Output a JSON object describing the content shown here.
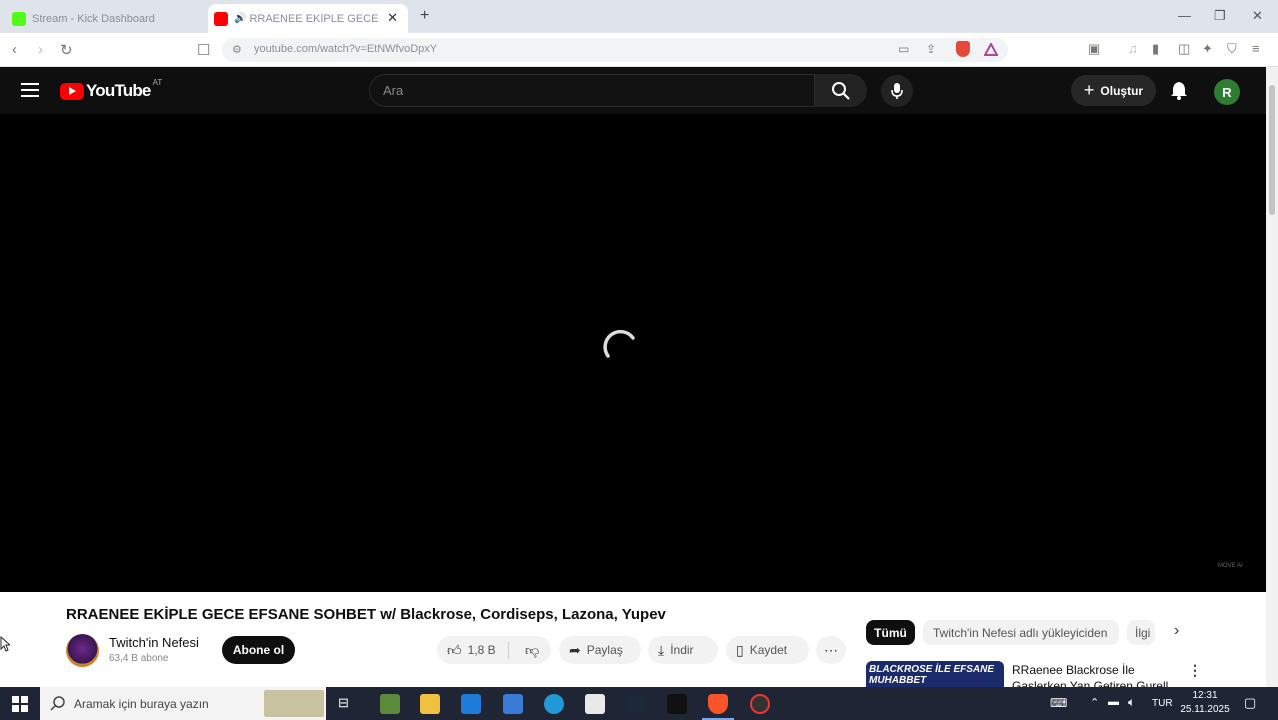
{
  "browser": {
    "tabs": [
      {
        "title": "Stream - Kick Dashboard",
        "active": false
      },
      {
        "title": "RRAENEE EKİPLE GECE EFSANE",
        "active": true
      }
    ],
    "url": "youtube.com/watch?v=EtNWfvoDpxY",
    "new_tab": "+"
  },
  "youtube": {
    "logo_text": "YouTube",
    "country_code": "AT",
    "search_placeholder": "Ara",
    "create_label": "Oluştur",
    "avatar_letter": "R",
    "video": {
      "title": "RRAENEE EKİPLE GECE EFSANE SOHBET w/ Blackrose, Cordiseps, Lazona, Yupev",
      "channel": "Twitch'in Nefesi",
      "subscribers": "63,4 B abone",
      "subscribe_label": "Abone ol",
      "likes": "1,8 B",
      "share_label": "Paylaş",
      "download_label": "İndir",
      "save_label": "Kaydet",
      "watermark": "MOVE AI"
    },
    "chips": [
      "Tümü",
      "Twitch'in Nefesi adlı yükleyiciden",
      "İlgi"
    ],
    "recommendation": {
      "thumb_text": "BLACKROSE İLE EFSANE MUHABBET",
      "title_line1": "RRaenee Blackrose İle",
      "title_line2": "Gaslerken Yan Getiren Gurell"
    }
  },
  "taskbar": {
    "search_placeholder": "Aramak için buraya yazın",
    "language": "TUR",
    "time": "12:31",
    "date": "25.11.2025"
  }
}
